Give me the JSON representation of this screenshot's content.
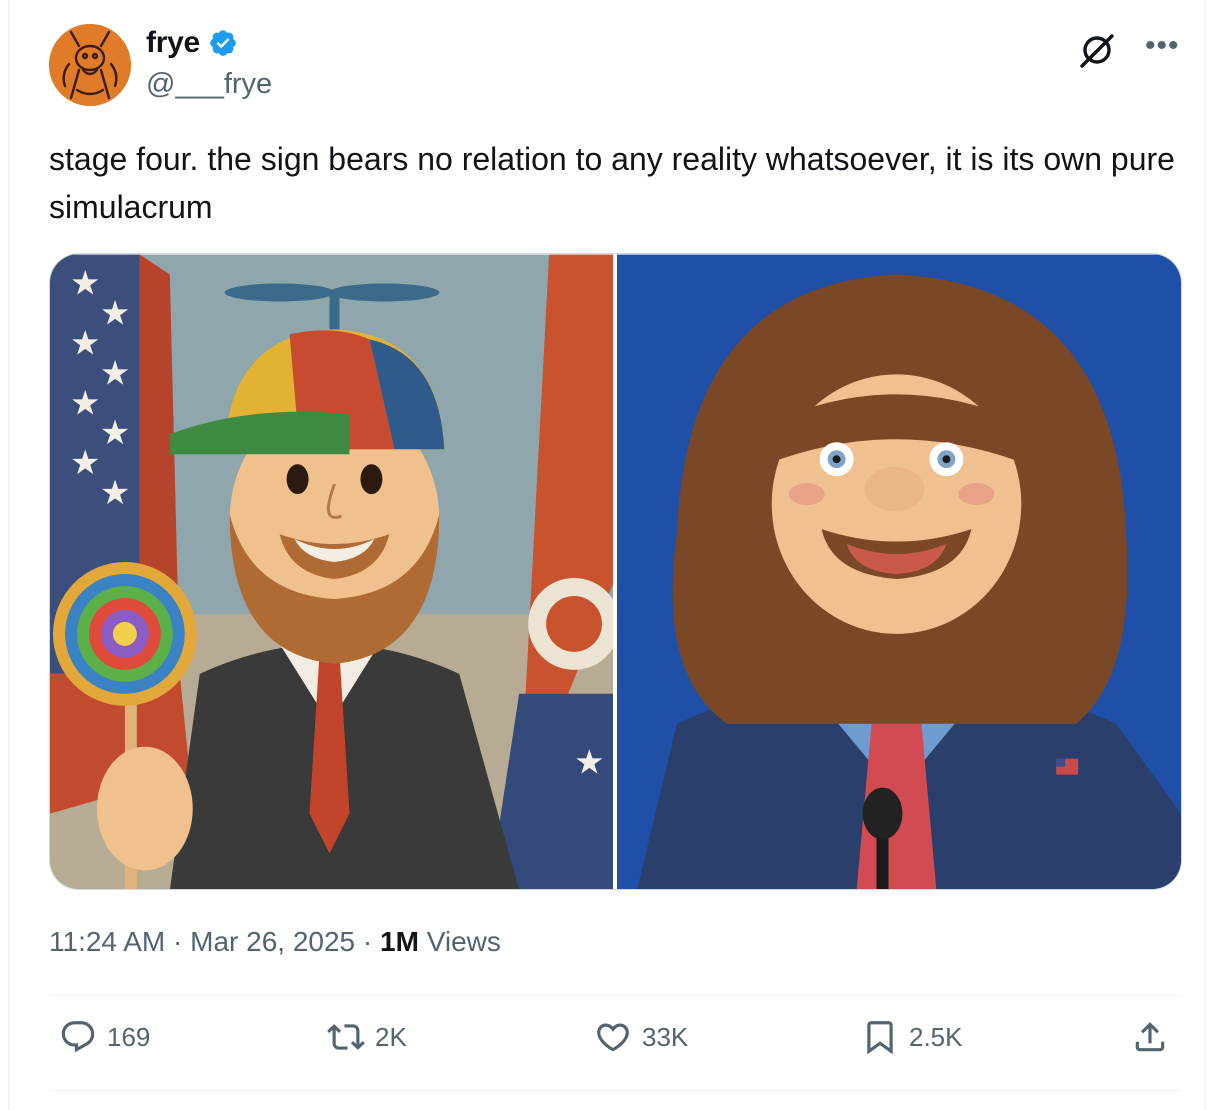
{
  "author": {
    "display_name": "frye",
    "handle": "@___frye",
    "verified": true
  },
  "tweet": {
    "text": "stage four. the sign bears no relation to any reality whatsoever, it is its own pure simulacrum"
  },
  "meta": {
    "time": "11:24 AM",
    "separator1": " · ",
    "date": "Mar 26, 2025",
    "separator2": " · ",
    "views_count": "1M",
    "views_label": " Views"
  },
  "actions": {
    "replies": "169",
    "reposts": "2K",
    "likes": "33K",
    "bookmarks": "2.5K"
  },
  "colors": {
    "text": "#0f1419",
    "secondary": "#536471",
    "verified": "#1d9bf0",
    "border": "#eff3f4"
  },
  "icons": [
    "verified-badge-icon",
    "grok-icon",
    "more-icon",
    "reply-icon",
    "repost-icon",
    "like-icon",
    "bookmark-icon",
    "share-icon"
  ]
}
